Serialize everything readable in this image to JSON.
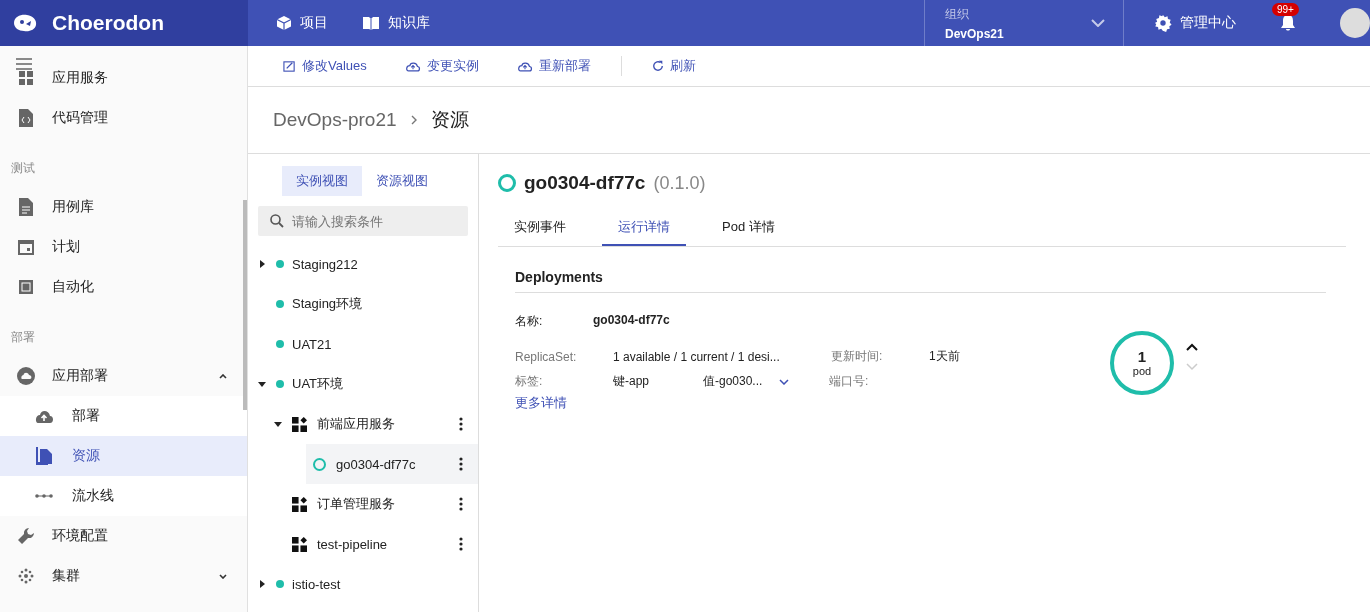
{
  "header": {
    "logo": "Choerodon",
    "nav": [
      {
        "label": "项目"
      },
      {
        "label": "知识库"
      }
    ],
    "org": {
      "label": "组织",
      "value": "DevOps21"
    },
    "admin": "管理中心",
    "notifications": "99+"
  },
  "toolbar": [
    {
      "label": "修改Values"
    },
    {
      "label": "变更实例"
    },
    {
      "label": "重新部署"
    },
    {
      "label": "刷新"
    }
  ],
  "breadcrumb": [
    "DevOps-pro21",
    "资源"
  ],
  "sidebar": {
    "sections": [
      {
        "items": [
          {
            "label": "应用服务",
            "selected": false
          },
          {
            "label": "代码管理",
            "selected": false
          }
        ]
      },
      {
        "title": "测试",
        "items": [
          {
            "label": "用例库",
            "selected": false
          },
          {
            "label": "计划",
            "selected": false
          },
          {
            "label": "自动化",
            "selected": false
          }
        ]
      },
      {
        "title": "部署",
        "items": [
          {
            "label": "应用部署",
            "selected": false,
            "expanded": true,
            "children": [
              {
                "label": "部署",
                "selected": false
              },
              {
                "label": "资源",
                "selected": true
              },
              {
                "label": "流水线",
                "selected": false
              }
            ]
          },
          {
            "label": "环境配置",
            "selected": false
          },
          {
            "label": "集群",
            "selected": false,
            "expanded": false
          }
        ]
      }
    ]
  },
  "tree": {
    "tabs": [
      {
        "label": "实例视图",
        "selected": true
      },
      {
        "label": "资源视图",
        "selected": false
      }
    ],
    "search": {
      "placeholder": "请输入搜索条件"
    },
    "nodes": [
      {
        "label": "Staging212",
        "kind": "env",
        "expanded": false,
        "selected": false
      },
      {
        "label": "Staging环境",
        "kind": "env",
        "selected": false
      },
      {
        "label": "UAT21",
        "kind": "env",
        "selected": false
      },
      {
        "label": "UAT环境",
        "kind": "env",
        "expanded": true,
        "selected": false,
        "children": [
          {
            "label": "前端应用服务",
            "kind": "app",
            "expanded": true,
            "selected": false,
            "children": [
              {
                "label": "go0304-df77c",
                "kind": "instance",
                "selected": true
              }
            ]
          },
          {
            "label": "订单管理服务",
            "kind": "app",
            "selected": false
          },
          {
            "label": "test-pipeline",
            "kind": "app",
            "selected": false
          }
        ]
      },
      {
        "label": "istio-test",
        "kind": "env",
        "expanded": false,
        "selected": false
      }
    ]
  },
  "detail": {
    "title": "go0304-df77c",
    "version": "(0.1.0)",
    "tabs": [
      {
        "label": "实例事件",
        "selected": false
      },
      {
        "label": "运行详情",
        "selected": true
      },
      {
        "label": "Pod 详情",
        "selected": false
      }
    ],
    "section": "Deployments",
    "name": {
      "label": "名称:",
      "value": "go0304-df77c"
    },
    "replicaset": {
      "label": "ReplicaSet:",
      "value": "1 available / 1 current / 1 desi..."
    },
    "updated": {
      "label": "更新时间:",
      "value": "1天前"
    },
    "labels": {
      "label": "标签:",
      "key": "键-app",
      "value": "值-go030..."
    },
    "ports": {
      "label": "端口号:"
    },
    "more": "更多详情",
    "pod": {
      "count": "1",
      "unit": "pod",
      "up_disabled": false,
      "down_disabled": true
    }
  }
}
